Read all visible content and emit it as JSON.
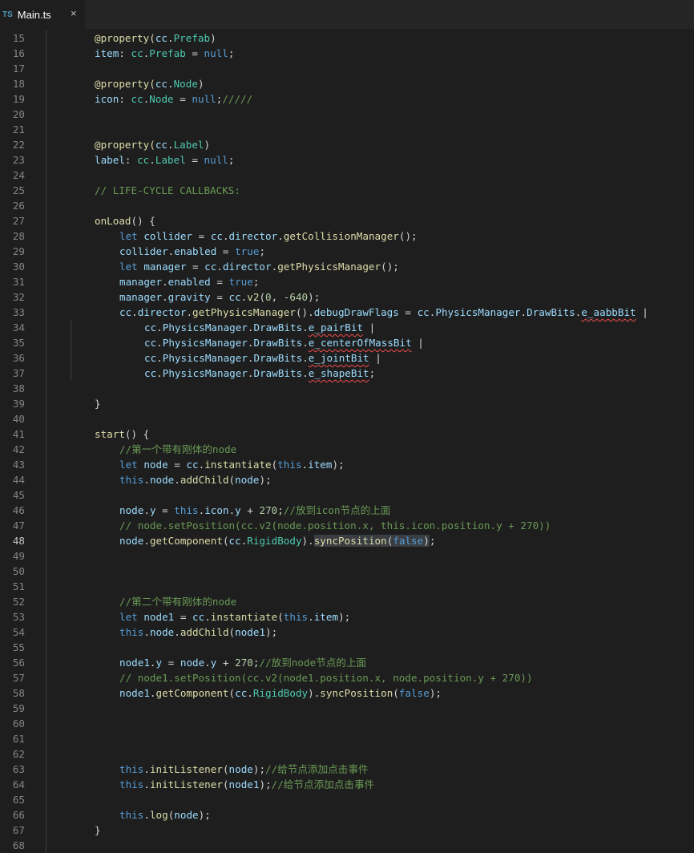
{
  "tab": {
    "icon": "TS",
    "name": "Main.ts",
    "close": "×"
  },
  "active_line": 48,
  "lines": [
    {
      "n": "15",
      "i": 2,
      "s": [
        [
          "@property(",
          "f"
        ],
        [
          "cc",
          "v"
        ],
        [
          ".",
          "p"
        ],
        [
          "Prefab",
          "t"
        ],
        [
          ")",
          "p"
        ]
      ]
    },
    {
      "n": "16",
      "i": 2,
      "s": [
        [
          "item",
          "v"
        ],
        [
          ": ",
          "p"
        ],
        [
          "cc",
          "t"
        ],
        [
          ".",
          "p"
        ],
        [
          "Prefab",
          "t"
        ],
        [
          " = ",
          "p"
        ],
        [
          "null",
          "k"
        ],
        [
          ";",
          "p"
        ]
      ]
    },
    {
      "n": "17",
      "i": 2,
      "s": []
    },
    {
      "n": "18",
      "i": 2,
      "s": [
        [
          "@property(",
          "f"
        ],
        [
          "cc",
          "v"
        ],
        [
          ".",
          "p"
        ],
        [
          "Node",
          "t"
        ],
        [
          ")",
          "p"
        ]
      ]
    },
    {
      "n": "19",
      "i": 2,
      "s": [
        [
          "icon",
          "v"
        ],
        [
          ": ",
          "p"
        ],
        [
          "cc",
          "t"
        ],
        [
          ".",
          "p"
        ],
        [
          "Node",
          "t"
        ],
        [
          " = ",
          "p"
        ],
        [
          "null",
          "k"
        ],
        [
          ";",
          "p"
        ],
        [
          "/////",
          "c"
        ]
      ]
    },
    {
      "n": "20",
      "i": 2,
      "s": []
    },
    {
      "n": "21",
      "i": 2,
      "s": []
    },
    {
      "n": "22",
      "i": 2,
      "s": [
        [
          "@property(",
          "f"
        ],
        [
          "cc",
          "v"
        ],
        [
          ".",
          "p"
        ],
        [
          "Label",
          "t"
        ],
        [
          ")",
          "p"
        ]
      ]
    },
    {
      "n": "23",
      "i": 2,
      "s": [
        [
          "label",
          "v"
        ],
        [
          ": ",
          "p"
        ],
        [
          "cc",
          "t"
        ],
        [
          ".",
          "p"
        ],
        [
          "Label",
          "t"
        ],
        [
          " = ",
          "p"
        ],
        [
          "null",
          "k"
        ],
        [
          ";",
          "p"
        ]
      ]
    },
    {
      "n": "24",
      "i": 2,
      "s": []
    },
    {
      "n": "25",
      "i": 2,
      "s": [
        [
          "// LIFE-CYCLE CALLBACKS:",
          "c"
        ]
      ]
    },
    {
      "n": "26",
      "i": 2,
      "s": []
    },
    {
      "n": "27",
      "i": 2,
      "s": [
        [
          "onLoad",
          "f"
        ],
        [
          "() {",
          "p"
        ]
      ]
    },
    {
      "n": "28",
      "i": 3,
      "s": [
        [
          "let ",
          "k"
        ],
        [
          "collider",
          "v"
        ],
        [
          " = ",
          "p"
        ],
        [
          "cc",
          "v"
        ],
        [
          ".",
          "p"
        ],
        [
          "director",
          "v"
        ],
        [
          ".",
          "p"
        ],
        [
          "getCollisionManager",
          "f"
        ],
        [
          "();",
          "p"
        ]
      ]
    },
    {
      "n": "29",
      "i": 3,
      "s": [
        [
          "collider",
          "v"
        ],
        [
          ".",
          "p"
        ],
        [
          "enabled",
          "v"
        ],
        [
          " = ",
          "p"
        ],
        [
          "true",
          "k"
        ],
        [
          ";",
          "p"
        ]
      ]
    },
    {
      "n": "30",
      "i": 3,
      "s": [
        [
          "let ",
          "k"
        ],
        [
          "manager",
          "v"
        ],
        [
          " = ",
          "p"
        ],
        [
          "cc",
          "v"
        ],
        [
          ".",
          "p"
        ],
        [
          "director",
          "v"
        ],
        [
          ".",
          "p"
        ],
        [
          "getPhysicsManager",
          "f"
        ],
        [
          "();",
          "p"
        ]
      ]
    },
    {
      "n": "31",
      "i": 3,
      "s": [
        [
          "manager",
          "v"
        ],
        [
          ".",
          "p"
        ],
        [
          "enabled",
          "v"
        ],
        [
          " = ",
          "p"
        ],
        [
          "true",
          "k"
        ],
        [
          ";",
          "p"
        ]
      ]
    },
    {
      "n": "32",
      "i": 3,
      "s": [
        [
          "manager",
          "v"
        ],
        [
          ".",
          "p"
        ],
        [
          "gravity",
          "v"
        ],
        [
          " = ",
          "p"
        ],
        [
          "cc",
          "v"
        ],
        [
          ".",
          "p"
        ],
        [
          "v2",
          "f"
        ],
        [
          "(",
          "p"
        ],
        [
          "0",
          "n"
        ],
        [
          ", -",
          "p"
        ],
        [
          "640",
          "n"
        ],
        [
          ");",
          "p"
        ]
      ]
    },
    {
      "n": "33",
      "i": 3,
      "s": [
        [
          "cc",
          "v"
        ],
        [
          ".",
          "p"
        ],
        [
          "director",
          "v"
        ],
        [
          ".",
          "p"
        ],
        [
          "getPhysicsManager",
          "f"
        ],
        [
          "().",
          "p"
        ],
        [
          "debugDrawFlags",
          "v"
        ],
        [
          " = ",
          "p"
        ],
        [
          "cc",
          "v"
        ],
        [
          ".",
          "p"
        ],
        [
          "PhysicsManager",
          "v"
        ],
        [
          ".",
          "p"
        ],
        [
          "DrawBits",
          "v"
        ],
        [
          ".",
          "p"
        ],
        [
          "e_aabbBit",
          "v",
          "sq"
        ],
        [
          " |",
          "p"
        ]
      ]
    },
    {
      "n": "34",
      "i": 4,
      "s": [
        [
          "cc",
          "v"
        ],
        [
          ".",
          "p"
        ],
        [
          "PhysicsManager",
          "v"
        ],
        [
          ".",
          "p"
        ],
        [
          "DrawBits",
          "v"
        ],
        [
          ".",
          "p"
        ],
        [
          "e_pairBit",
          "v",
          "sq"
        ],
        [
          " |",
          "p"
        ]
      ]
    },
    {
      "n": "35",
      "i": 4,
      "s": [
        [
          "cc",
          "v"
        ],
        [
          ".",
          "p"
        ],
        [
          "PhysicsManager",
          "v"
        ],
        [
          ".",
          "p"
        ],
        [
          "DrawBits",
          "v"
        ],
        [
          ".",
          "p"
        ],
        [
          "e_centerOfMassBit",
          "v",
          "sq"
        ],
        [
          " |",
          "p"
        ]
      ]
    },
    {
      "n": "36",
      "i": 4,
      "s": [
        [
          "cc",
          "v"
        ],
        [
          ".",
          "p"
        ],
        [
          "PhysicsManager",
          "v"
        ],
        [
          ".",
          "p"
        ],
        [
          "DrawBits",
          "v"
        ],
        [
          ".",
          "p"
        ],
        [
          "e_jointBit",
          "v",
          "sq"
        ],
        [
          " |",
          "p"
        ]
      ]
    },
    {
      "n": "37",
      "i": 4,
      "s": [
        [
          "cc",
          "v"
        ],
        [
          ".",
          "p"
        ],
        [
          "PhysicsManager",
          "v"
        ],
        [
          ".",
          "p"
        ],
        [
          "DrawBits",
          "v"
        ],
        [
          ".",
          "p"
        ],
        [
          "e_shapeBit",
          "v",
          "sq"
        ],
        [
          ";",
          "p"
        ]
      ]
    },
    {
      "n": "38",
      "i": 3,
      "s": []
    },
    {
      "n": "39",
      "i": 2,
      "s": [
        [
          "}",
          "p"
        ]
      ]
    },
    {
      "n": "40",
      "i": 2,
      "s": []
    },
    {
      "n": "41",
      "i": 2,
      "s": [
        [
          "start",
          "f"
        ],
        [
          "() {",
          "p"
        ]
      ]
    },
    {
      "n": "42",
      "i": 3,
      "s": [
        [
          "//第一个带有刚体的node",
          "c"
        ]
      ]
    },
    {
      "n": "43",
      "i": 3,
      "s": [
        [
          "let ",
          "k"
        ],
        [
          "node",
          "v"
        ],
        [
          " = ",
          "p"
        ],
        [
          "cc",
          "v"
        ],
        [
          ".",
          "p"
        ],
        [
          "instantiate",
          "f"
        ],
        [
          "(",
          "p"
        ],
        [
          "this",
          "k"
        ],
        [
          ".",
          "p"
        ],
        [
          "item",
          "v"
        ],
        [
          ");",
          "p"
        ]
      ]
    },
    {
      "n": "44",
      "i": 3,
      "s": [
        [
          "this",
          "k"
        ],
        [
          ".",
          "p"
        ],
        [
          "node",
          "v"
        ],
        [
          ".",
          "p"
        ],
        [
          "addChild",
          "f"
        ],
        [
          "(",
          "p"
        ],
        [
          "node",
          "v"
        ],
        [
          ");",
          "p"
        ]
      ]
    },
    {
      "n": "45",
      "i": 3,
      "s": []
    },
    {
      "n": "46",
      "i": 3,
      "s": [
        [
          "node",
          "v"
        ],
        [
          ".",
          "p"
        ],
        [
          "y",
          "v"
        ],
        [
          " = ",
          "p"
        ],
        [
          "this",
          "k"
        ],
        [
          ".",
          "p"
        ],
        [
          "icon",
          "v"
        ],
        [
          ".",
          "p"
        ],
        [
          "y",
          "v"
        ],
        [
          " + ",
          "p"
        ],
        [
          "270",
          "n"
        ],
        [
          ";",
          "p"
        ],
        [
          "//放到icon节点的上面",
          "c"
        ]
      ]
    },
    {
      "n": "47",
      "i": 3,
      "s": [
        [
          "// node.setPosition(cc.v2(node.position.x, this.icon.position.y + 270))",
          "c"
        ]
      ]
    },
    {
      "n": "48",
      "i": 3,
      "s": [
        [
          "node",
          "v"
        ],
        [
          ".",
          "p"
        ],
        [
          "getComponent",
          "f"
        ],
        [
          "(",
          "p"
        ],
        [
          "cc",
          "v"
        ],
        [
          ".",
          "p"
        ],
        [
          "RigidBody",
          "t"
        ],
        [
          ").",
          "p"
        ],
        [
          "syncPosition",
          "f",
          "hl"
        ],
        [
          "(",
          "p",
          "hl"
        ],
        [
          "false",
          "k",
          "hl"
        ],
        [
          ")",
          "p",
          "hl"
        ],
        [
          ";",
          "p"
        ]
      ]
    },
    {
      "n": "49",
      "i": 3,
      "s": []
    },
    {
      "n": "50",
      "i": 3,
      "s": []
    },
    {
      "n": "51",
      "i": 3,
      "s": []
    },
    {
      "n": "52",
      "i": 3,
      "s": [
        [
          "//第二个带有刚体的node",
          "c"
        ]
      ]
    },
    {
      "n": "53",
      "i": 3,
      "s": [
        [
          "let ",
          "k"
        ],
        [
          "node1",
          "v"
        ],
        [
          " = ",
          "p"
        ],
        [
          "cc",
          "v"
        ],
        [
          ".",
          "p"
        ],
        [
          "instantiate",
          "f"
        ],
        [
          "(",
          "p"
        ],
        [
          "this",
          "k"
        ],
        [
          ".",
          "p"
        ],
        [
          "item",
          "v"
        ],
        [
          ");",
          "p"
        ]
      ]
    },
    {
      "n": "54",
      "i": 3,
      "s": [
        [
          "this",
          "k"
        ],
        [
          ".",
          "p"
        ],
        [
          "node",
          "v"
        ],
        [
          ".",
          "p"
        ],
        [
          "addChild",
          "f"
        ],
        [
          "(",
          "p"
        ],
        [
          "node1",
          "v"
        ],
        [
          ");",
          "p"
        ]
      ]
    },
    {
      "n": "55",
      "i": 3,
      "s": []
    },
    {
      "n": "56",
      "i": 3,
      "s": [
        [
          "node1",
          "v"
        ],
        [
          ".",
          "p"
        ],
        [
          "y",
          "v"
        ],
        [
          " = ",
          "p"
        ],
        [
          "node",
          "v"
        ],
        [
          ".",
          "p"
        ],
        [
          "y",
          "v"
        ],
        [
          " + ",
          "p"
        ],
        [
          "270",
          "n"
        ],
        [
          ";",
          "p"
        ],
        [
          "//放到node节点的上面",
          "c"
        ]
      ]
    },
    {
      "n": "57",
      "i": 3,
      "s": [
        [
          "// node1.setPosition(cc.v2(node1.position.x, node.position.y + 270))",
          "c"
        ]
      ]
    },
    {
      "n": "58",
      "i": 3,
      "s": [
        [
          "node1",
          "v"
        ],
        [
          ".",
          "p"
        ],
        [
          "getComponent",
          "f"
        ],
        [
          "(",
          "p"
        ],
        [
          "cc",
          "v"
        ],
        [
          ".",
          "p"
        ],
        [
          "RigidBody",
          "t"
        ],
        [
          ").",
          "p"
        ],
        [
          "syncPosition",
          "f"
        ],
        [
          "(",
          "p"
        ],
        [
          "false",
          "k"
        ],
        [
          ");",
          "p"
        ]
      ]
    },
    {
      "n": "59",
      "i": 3,
      "s": []
    },
    {
      "n": "60",
      "i": 3,
      "s": []
    },
    {
      "n": "61",
      "i": 3,
      "s": []
    },
    {
      "n": "62",
      "i": 3,
      "s": []
    },
    {
      "n": "63",
      "i": 3,
      "s": [
        [
          "this",
          "k"
        ],
        [
          ".",
          "p"
        ],
        [
          "initListener",
          "f"
        ],
        [
          "(",
          "p"
        ],
        [
          "node",
          "v"
        ],
        [
          ");",
          "p"
        ],
        [
          "//给节点添加点击事件",
          "c"
        ]
      ]
    },
    {
      "n": "64",
      "i": 3,
      "s": [
        [
          "this",
          "k"
        ],
        [
          ".",
          "p"
        ],
        [
          "initListener",
          "f"
        ],
        [
          "(",
          "p"
        ],
        [
          "node1",
          "v"
        ],
        [
          ");",
          "p"
        ],
        [
          "//给节点添加点击事件",
          "c"
        ]
      ]
    },
    {
      "n": "65",
      "i": 3,
      "s": []
    },
    {
      "n": "66",
      "i": 3,
      "s": [
        [
          "this",
          "k"
        ],
        [
          ".",
          "p"
        ],
        [
          "log",
          "f"
        ],
        [
          "(",
          "p"
        ],
        [
          "node",
          "v"
        ],
        [
          ");",
          "p"
        ]
      ]
    },
    {
      "n": "67",
      "i": 2,
      "s": [
        [
          "}",
          "p"
        ]
      ]
    },
    {
      "n": "68",
      "i": 2,
      "s": []
    }
  ]
}
